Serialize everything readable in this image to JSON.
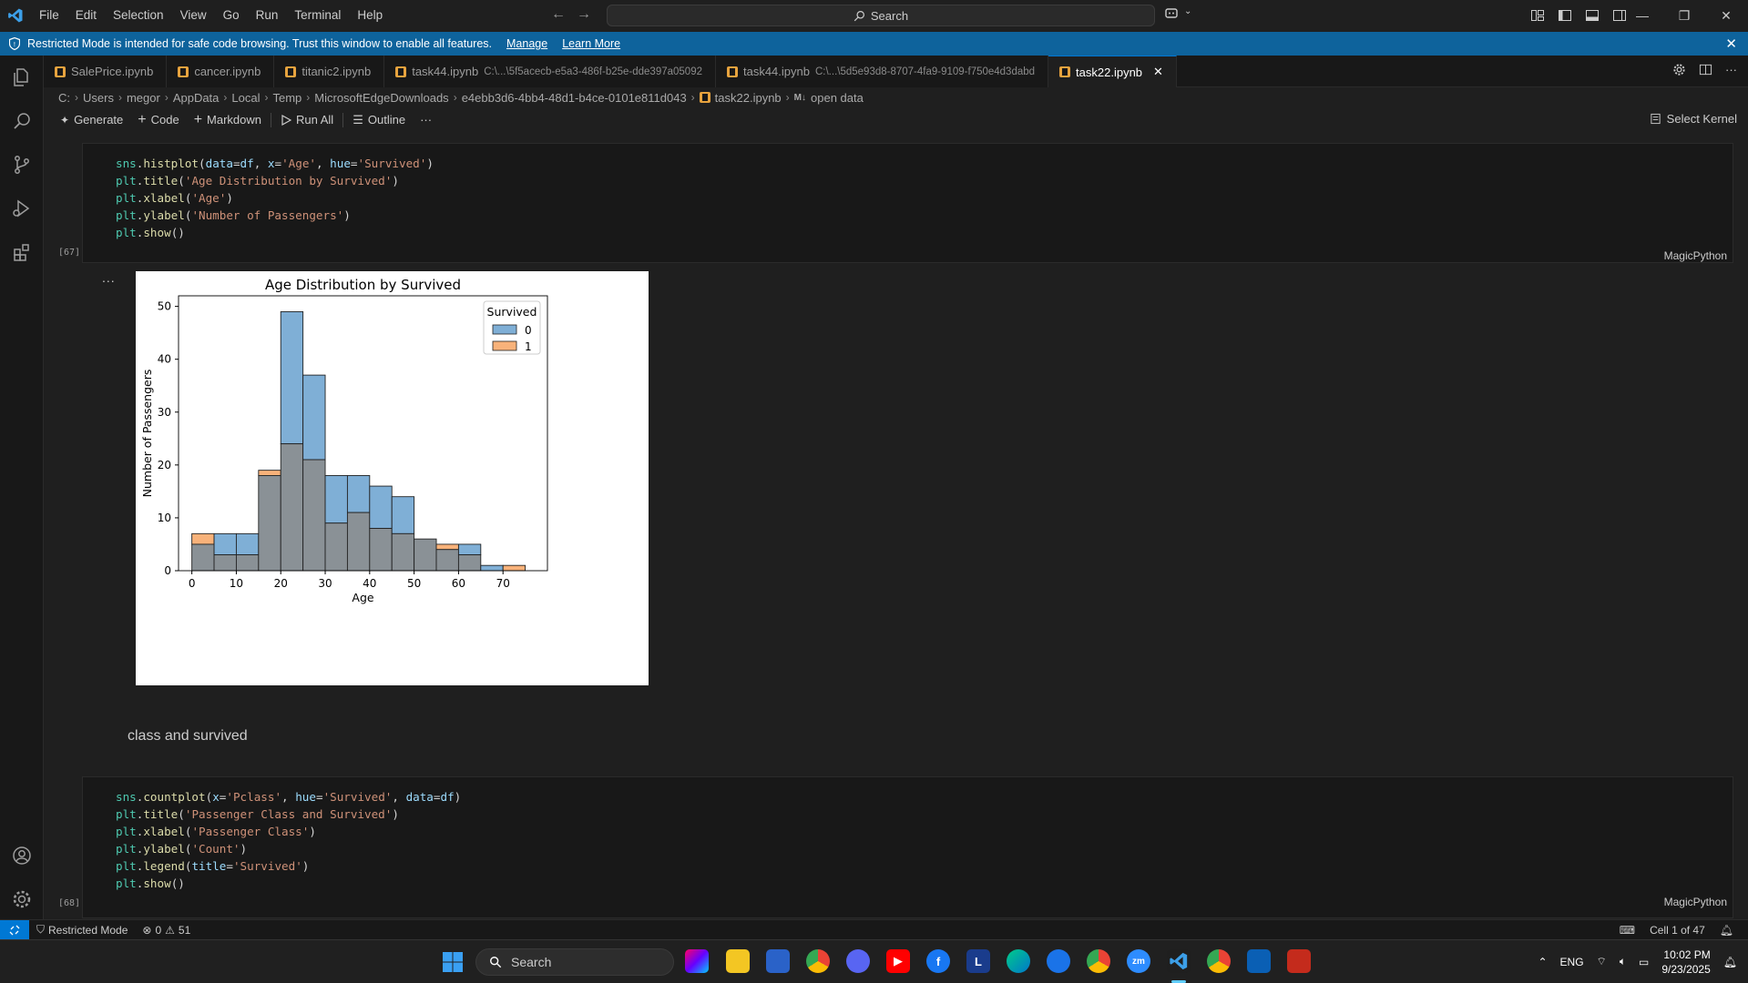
{
  "menu": [
    "File",
    "Edit",
    "Selection",
    "View",
    "Go",
    "Run",
    "Terminal",
    "Help"
  ],
  "search_label": "Search",
  "banner": {
    "text": "Restricted Mode is intended for safe code browsing. Trust this window to enable all features.",
    "manage": "Manage",
    "learn_more": "Learn More"
  },
  "tabs": [
    {
      "label": "SalePrice.ipynb",
      "path": ""
    },
    {
      "label": "cancer.ipynb",
      "path": ""
    },
    {
      "label": "titanic2.ipynb",
      "path": ""
    },
    {
      "label": "task44.ipynb",
      "path": "C:\\...\\5f5acecb-e5a3-486f-b25e-dde397a05092"
    },
    {
      "label": "task44.ipynb",
      "path": "C:\\...\\5d5e93d8-8707-4fa9-9109-f750e4d3dabd"
    },
    {
      "label": "task22.ipynb",
      "path": ""
    }
  ],
  "breadcrumb": [
    "C:",
    "Users",
    "megor",
    "AppData",
    "Local",
    "Temp",
    "MicrosoftEdgeDownloads",
    "e4ebb3d6-4bb4-48d1-b4ce-0101e811d043",
    "task22.ipynb",
    "open data"
  ],
  "breadcrumb_md": "M↓",
  "toolbar": {
    "generate": "Generate",
    "code": "Code",
    "markdown": "Markdown",
    "run_all": "Run All",
    "outline": "Outline",
    "more": "···",
    "select_kernel": "Select Kernel"
  },
  "cell1": {
    "exec": "[67]",
    "lang": "MagicPython",
    "lines": [
      [
        [
          "mod",
          "sns"
        ],
        [
          "txt",
          "."
        ],
        [
          "fn",
          "histplot"
        ],
        [
          "txt",
          "("
        ],
        [
          "kw",
          "data"
        ],
        [
          "txt",
          "="
        ],
        [
          "kw",
          "df"
        ],
        [
          "txt",
          ", "
        ],
        [
          "kw",
          "x"
        ],
        [
          "txt",
          "="
        ],
        [
          "str",
          "'Age'"
        ],
        [
          "txt",
          ", "
        ],
        [
          "kw",
          "hue"
        ],
        [
          "txt",
          "="
        ],
        [
          "str",
          "'Survived'"
        ],
        [
          "txt",
          ")"
        ]
      ],
      [
        [
          "mod",
          "plt"
        ],
        [
          "txt",
          "."
        ],
        [
          "fn",
          "title"
        ],
        [
          "txt",
          "("
        ],
        [
          "str",
          "'Age Distribution by Survived'"
        ],
        [
          "txt",
          ")"
        ]
      ],
      [
        [
          "mod",
          "plt"
        ],
        [
          "txt",
          "."
        ],
        [
          "fn",
          "xlabel"
        ],
        [
          "txt",
          "("
        ],
        [
          "str",
          "'Age'"
        ],
        [
          "txt",
          ")"
        ]
      ],
      [
        [
          "mod",
          "plt"
        ],
        [
          "txt",
          "."
        ],
        [
          "fn",
          "ylabel"
        ],
        [
          "txt",
          "("
        ],
        [
          "str",
          "'Number of Passengers'"
        ],
        [
          "txt",
          ")"
        ]
      ],
      [
        [
          "mod",
          "plt"
        ],
        [
          "txt",
          "."
        ],
        [
          "fn",
          "show"
        ],
        [
          "txt",
          "()"
        ]
      ]
    ]
  },
  "output_dots": "...",
  "markdown_text": "class and survived",
  "cell2": {
    "exec": "[68]",
    "lang": "MagicPython",
    "lines": [
      [
        [
          "mod",
          "sns"
        ],
        [
          "txt",
          "."
        ],
        [
          "fn",
          "countplot"
        ],
        [
          "txt",
          "("
        ],
        [
          "kw",
          "x"
        ],
        [
          "txt",
          "="
        ],
        [
          "str",
          "'Pclass'"
        ],
        [
          "txt",
          ", "
        ],
        [
          "kw",
          "hue"
        ],
        [
          "txt",
          "="
        ],
        [
          "str",
          "'Survived'"
        ],
        [
          "txt",
          ", "
        ],
        [
          "kw",
          "data"
        ],
        [
          "txt",
          "="
        ],
        [
          "kw",
          "df"
        ],
        [
          "txt",
          ")"
        ]
      ],
      [
        [
          "mod",
          "plt"
        ],
        [
          "txt",
          "."
        ],
        [
          "fn",
          "title"
        ],
        [
          "txt",
          "("
        ],
        [
          "str",
          "'Passenger Class and Survived'"
        ],
        [
          "txt",
          ")"
        ]
      ],
      [
        [
          "mod",
          "plt"
        ],
        [
          "txt",
          "."
        ],
        [
          "fn",
          "xlabel"
        ],
        [
          "txt",
          "("
        ],
        [
          "str",
          "'Passenger Class'"
        ],
        [
          "txt",
          ")"
        ]
      ],
      [
        [
          "mod",
          "plt"
        ],
        [
          "txt",
          "."
        ],
        [
          "fn",
          "ylabel"
        ],
        [
          "txt",
          "("
        ],
        [
          "str",
          "'Count'"
        ],
        [
          "txt",
          ")"
        ]
      ],
      [
        [
          "mod",
          "plt"
        ],
        [
          "txt",
          "."
        ],
        [
          "fn",
          "legend"
        ],
        [
          "txt",
          "("
        ],
        [
          "kw",
          "title"
        ],
        [
          "txt",
          "="
        ],
        [
          "str",
          "'Survived'"
        ],
        [
          "txt",
          ")"
        ]
      ],
      [
        [
          "mod",
          "plt"
        ],
        [
          "txt",
          "."
        ],
        [
          "fn",
          "show"
        ],
        [
          "txt",
          "()"
        ]
      ]
    ]
  },
  "chart_data": {
    "type": "bar",
    "title": "Age Distribution by Survived",
    "xlabel": "Age",
    "ylabel": "Number of Passengers",
    "xlim": [
      -3,
      80
    ],
    "ylim": [
      0,
      52
    ],
    "xticks": [
      0,
      10,
      20,
      30,
      40,
      50,
      60,
      70
    ],
    "yticks": [
      0,
      10,
      20,
      30,
      40,
      50
    ],
    "bin_edges": [
      0,
      5,
      10,
      15,
      20,
      25,
      30,
      35,
      40,
      45,
      50,
      55,
      60,
      65,
      70,
      75
    ],
    "legend_title": "Survived",
    "legend_position": "top-right",
    "grid": false,
    "series": [
      {
        "name": "0",
        "color": "#7fafd6",
        "values": [
          5,
          7,
          7,
          18,
          49,
          37,
          18,
          18,
          16,
          14,
          6,
          4,
          5,
          1,
          0
        ]
      },
      {
        "name": "1",
        "color": "#f8b27a",
        "values": [
          7,
          3,
          3,
          19,
          24,
          21,
          9,
          11,
          8,
          7,
          6,
          5,
          3,
          0,
          1
        ]
      }
    ],
    "overlap_color": "#8a9196"
  },
  "status": {
    "restricted": "Restricted Mode",
    "errors": "0",
    "warnings": "51",
    "cell": "Cell 1 of 47"
  },
  "taskbar": {
    "search": "Search",
    "lang": "ENG",
    "time": "10:02 PM",
    "date": "9/23/2025"
  }
}
